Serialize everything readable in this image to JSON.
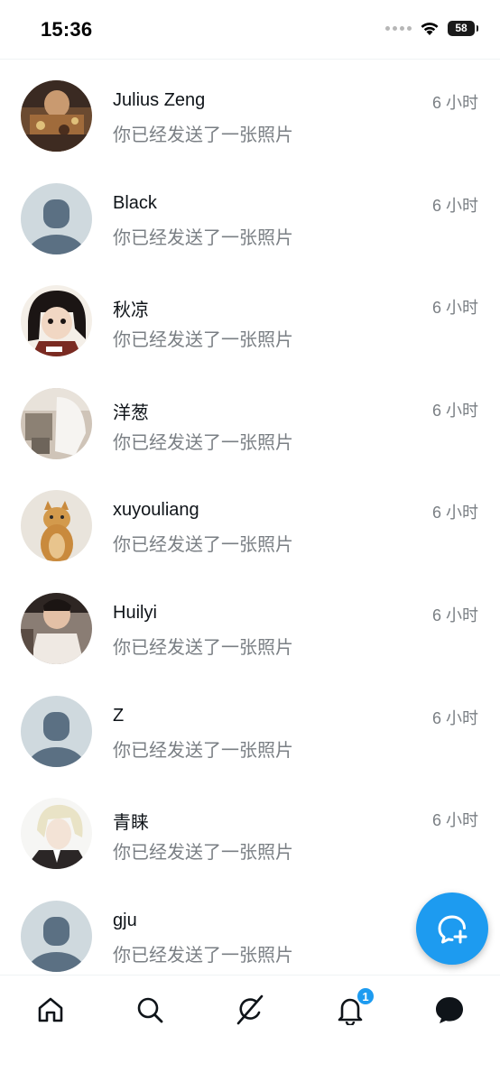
{
  "status_bar": {
    "time": "15:36",
    "battery": "58"
  },
  "messages": [
    {
      "name": "Julius Zeng",
      "time": "6 小时",
      "preview": "你已经发送了一张照片",
      "avatar": "photo-avatar"
    },
    {
      "name": "Black",
      "time": "6 小时",
      "preview": "你已经发送了一张照片",
      "avatar": "default-avatar"
    },
    {
      "name": "秋凉",
      "time": "6 小时",
      "preview": "你已经发送了一张照片",
      "avatar": "anime-avatar"
    },
    {
      "name": "洋葱",
      "time": "6 小时",
      "preview": "你已经发送了一张照片",
      "avatar": "photo-avatar"
    },
    {
      "name": "xuyouliang",
      "time": "6 小时",
      "preview": "你已经发送了一张照片",
      "avatar": "cat-avatar"
    },
    {
      "name": "Huilyi",
      "time": "6 小时",
      "preview": "你已经发送了一张照片",
      "avatar": "photo-avatar"
    },
    {
      "name": "Z",
      "time": "6 小时",
      "preview": "你已经发送了一张照片",
      "avatar": "default-avatar"
    },
    {
      "name": "青睐",
      "time": "6 小时",
      "preview": "你已经发送了一张照片",
      "avatar": "anime-avatar"
    },
    {
      "name": "gju",
      "time": "",
      "preview": "你已经发送了一张照片",
      "avatar": "default-avatar"
    }
  ],
  "fab": {
    "icon": "new-message-icon"
  },
  "tab_bar": {
    "tabs": [
      "home-icon",
      "search-icon",
      "grok-icon",
      "notifications-icon",
      "messages-icon"
    ],
    "notification_badge": "1"
  },
  "colors": {
    "accent": "#1d9bf0",
    "secondary_text": "#7a7f84",
    "default_avatar_bg": "#cfd9de",
    "default_avatar_fg": "#5b7083"
  }
}
